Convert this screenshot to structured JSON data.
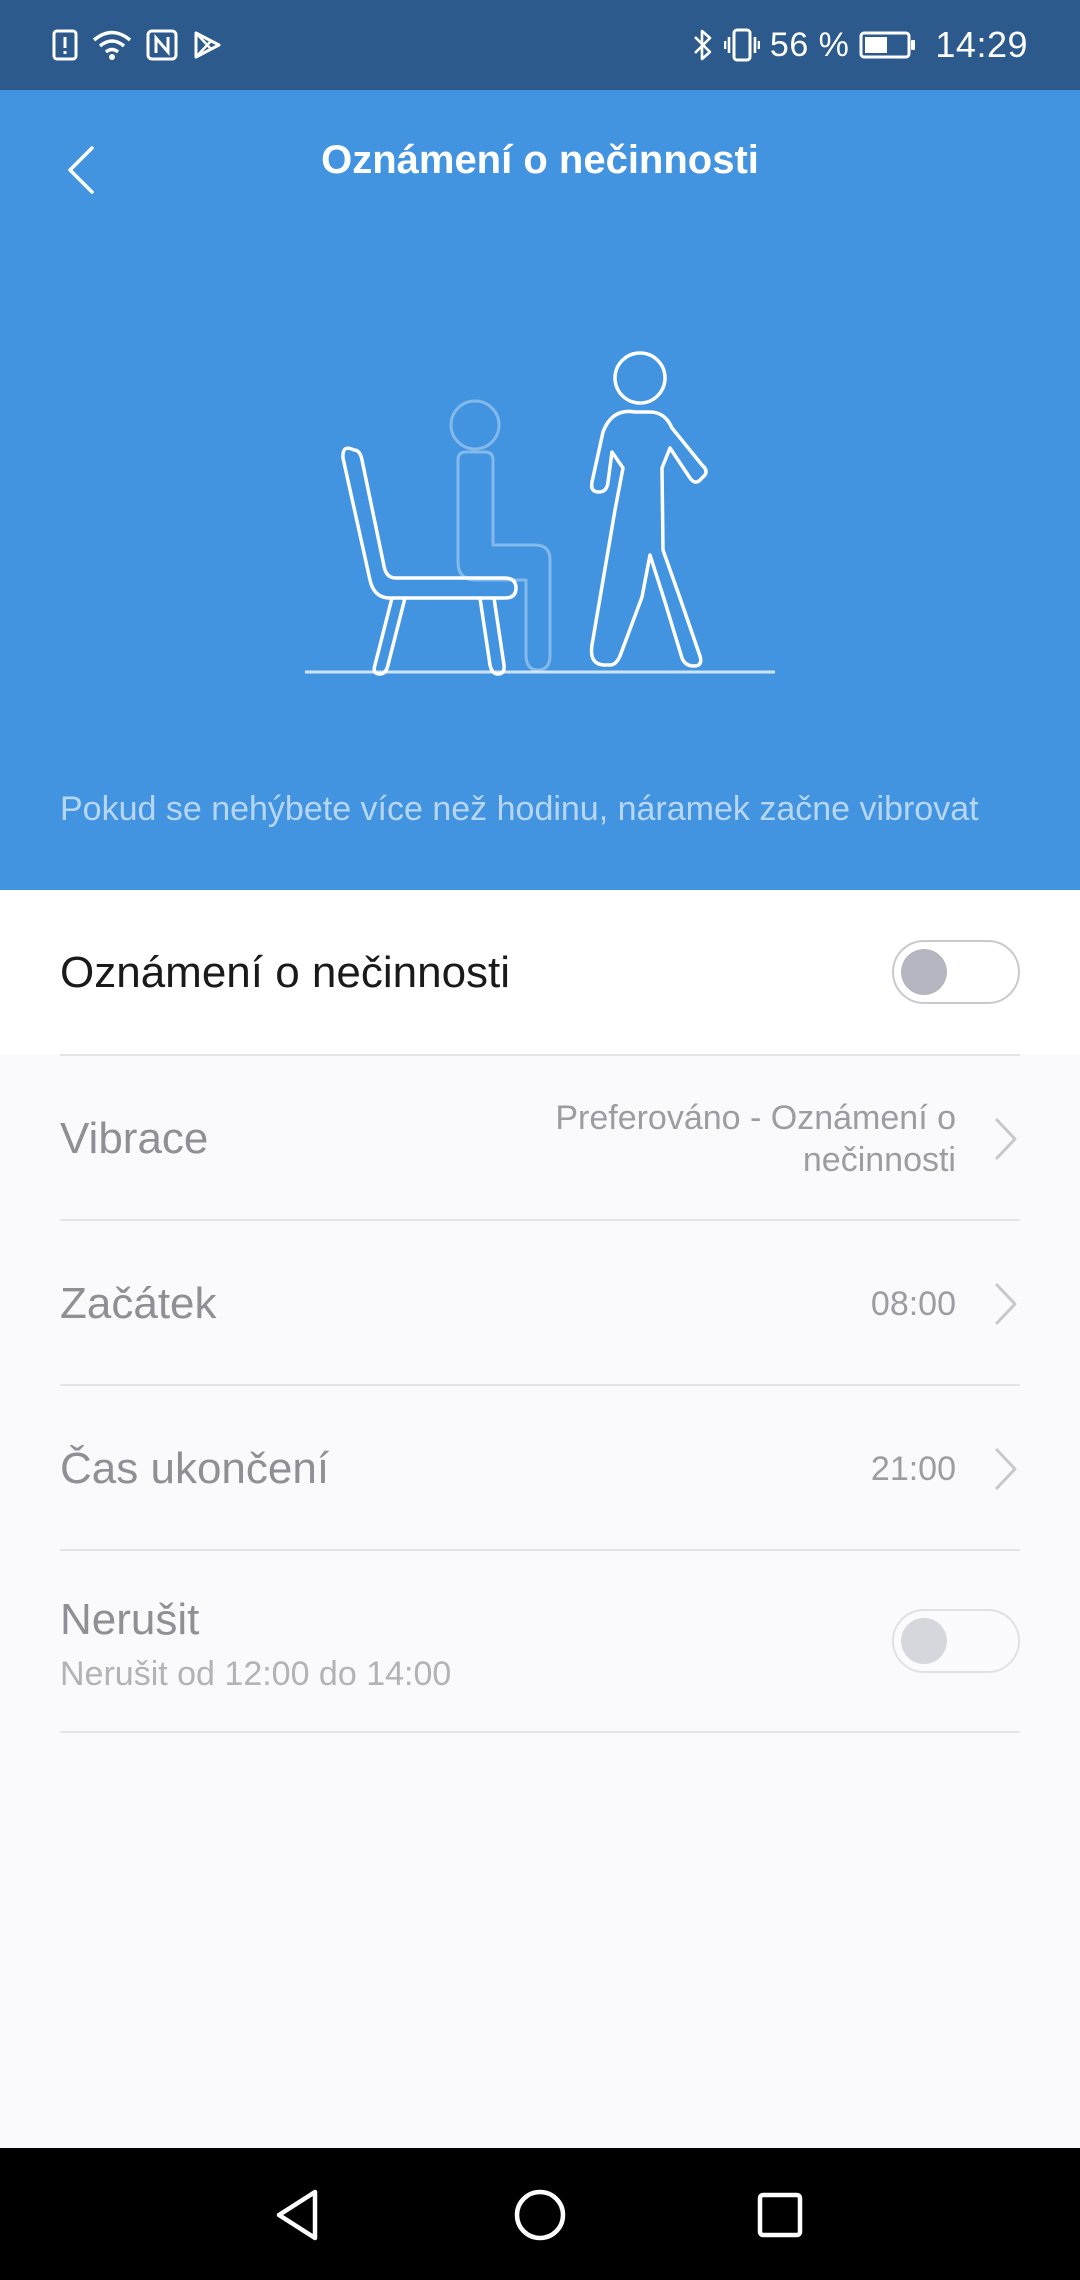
{
  "status_bar": {
    "icons_left": [
      "alert-icon",
      "wifi-icon",
      "nfc-icon",
      "play-store-icon"
    ],
    "icons_right": [
      "bluetooth-icon",
      "vibrate-icon",
      "battery-icon"
    ],
    "battery_percent": "56 %",
    "battery_level": 0.56,
    "time": "14:29"
  },
  "header": {
    "title": "Oznámení o nečinnosti",
    "back_icon": "chevron-left-icon"
  },
  "hero": {
    "illustration": "sitting-and-walking-person-illustration",
    "description": "Pokud se nehýbete více než hodinu, náramek začne vibrovat"
  },
  "settings": {
    "main_toggle": {
      "label": "Oznámení o nečinnosti",
      "on": false
    },
    "vibration": {
      "label": "Vibrace",
      "value_line1": "Preferováno - Oznámení o",
      "value_line2": "nečinnosti"
    },
    "start": {
      "label": "Začátek",
      "value": "08:00"
    },
    "end": {
      "label": "Čas ukončení",
      "value": "21:00"
    },
    "dnd": {
      "label": "Nerušit",
      "sublabel": "Nerušit od 12:00 do 14:00",
      "on": false
    }
  },
  "nav_bar": {
    "buttons": [
      "back-triangle-icon",
      "home-circle-icon",
      "recents-square-icon"
    ]
  },
  "colors": {
    "status_bar": "#2c5a8c",
    "hero": "#4294e0",
    "background": "#faf9fc"
  }
}
